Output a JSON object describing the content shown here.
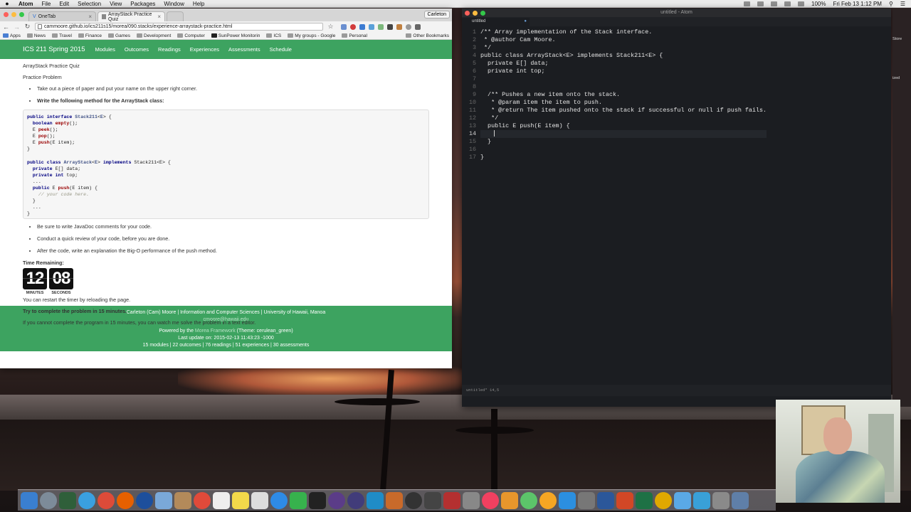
{
  "menubar": {
    "app": "Atom",
    "items": [
      "File",
      "Edit",
      "Selection",
      "View",
      "Packages",
      "Window",
      "Help"
    ],
    "battery": "100%",
    "clock": "Fri Feb 13  1:12 PM"
  },
  "browser": {
    "tabs": [
      {
        "title": "OneTab"
      },
      {
        "title": "ArrayStack Practice Quiz"
      }
    ],
    "profile": "Carleton",
    "url": "cammoore.github.io/ics211s15/morea/090.stacks/experience-arraystack-practice.html",
    "bookmarks": [
      "Apps",
      "News",
      "Travel",
      "Finance",
      "Games",
      "Development",
      "Computer",
      "SunPower Monitorin",
      "ICS",
      "My groups - Google",
      "Personal"
    ],
    "other_bookmarks": "Other Bookmarks"
  },
  "site": {
    "title": "ICS 211 Spring 2015",
    "nav": [
      "Modules",
      "Outcomes",
      "Readings",
      "Experiences",
      "Assessments",
      "Schedule"
    ],
    "heading": "ArrayStack Practice Quiz",
    "subheading": "Practice Problem",
    "bullet1": "Take out a piece of paper and put your name on the upper right corner.",
    "bullet2": "Write the following method for the ArrayStack class:",
    "bullets_after": [
      "Be sure to write JavaDoc comments for your code.",
      "Conduct a quick review of your code, before you are done.",
      "After the code, write an explanation the Big-O performance of the push method."
    ],
    "time_remaining": "Time Remaining:",
    "timer": {
      "minutes": "12",
      "seconds": "08",
      "minutes_label": "MINUTES",
      "seconds_label": "SECONDS"
    },
    "restart_note": "You can restart the timer by reloading the page.",
    "try_line": "Try to complete the problem in 15 minutes.",
    "cannot_line": "If you cannot complete the program in 15 minutes, you can watch me solve the problem in a text editor.",
    "footer": {
      "line1": "Carleton (Cam) Moore | Information and Computer Sciences | University of Hawaii, Manoa",
      "email": "cmoore@hawaii.edu",
      "powered_prefix": "Powered by the ",
      "powered_link": "Morea Framework",
      "powered_suffix": " (Theme: cerulean_green)",
      "updated": "Last update on: 2015-02-13 11:43:23 -1000",
      "stats": "15 modules | 22 outcomes | 76 readings | 51 experiences | 30 assessments"
    }
  },
  "atom": {
    "window_title": "untitled - Atom",
    "tab": "untitled",
    "lines": [
      "/** Array implementation of the Stack interface.",
      " * @author Cam Moore.",
      " */",
      "public class ArrayStack<E> implements Stack211<E> {",
      "  private E[] data;",
      "  private int top;",
      "",
      "",
      "  /** Pushes a new item onto the stack.",
      "   * @param item the item to push.",
      "   * @return The item pushed onto the stack if successful or null if push fails.",
      "   */",
      "  public E push(E item) {",
      "    ",
      "  }",
      "",
      "}"
    ],
    "status": "untitled*   14,5"
  },
  "desktop_right_labels": [
    "Store",
    "ized"
  ],
  "colors": {
    "site_green": "#3da360",
    "atom_bg": "#1b1d21"
  }
}
